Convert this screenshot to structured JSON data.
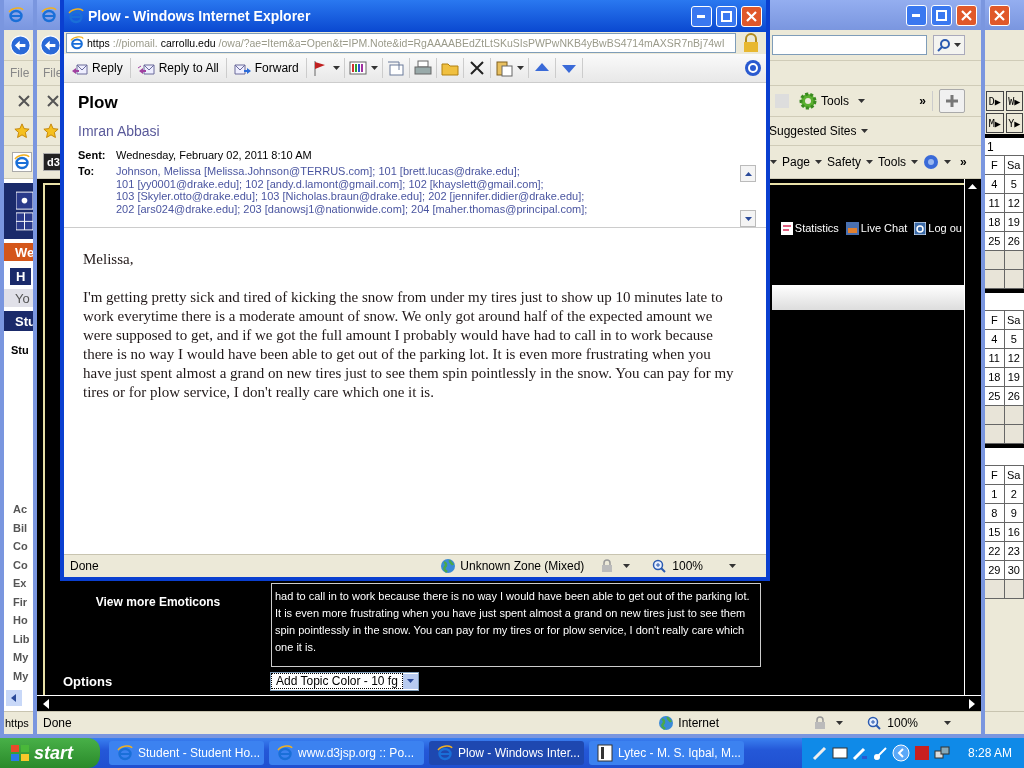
{
  "student_window": {
    "menu_label": "File",
    "sidebar": {
      "banner": "We",
      "tab": "H",
      "greeting": "Yo",
      "section_title": "Stu",
      "heading": "Stu",
      "links": [
        "Ac",
        "Bil",
        "Co",
        "Co",
        "Ex",
        "Fir",
        "Ho",
        "Lib",
        "My",
        "My"
      ]
    },
    "status": "https",
    "calendar": {
      "nav_buttons": [
        "D▶",
        "W▶",
        "M▶",
        "Y▶"
      ],
      "months": [
        {
          "title": "1",
          "headers": [
            "F",
            "Sa"
          ],
          "weeks": [
            {
              "kind": "days",
              "days": [
                "4",
                "5"
              ]
            },
            {
              "kind": "days",
              "days": [
                "11",
                "12"
              ]
            },
            {
              "kind": "days",
              "days": [
                "18",
                "19"
              ]
            },
            {
              "kind": "days",
              "days": [
                "25",
                "26"
              ]
            },
            {
              "kind": "blank"
            },
            {
              "kind": "blank"
            }
          ]
        },
        {
          "headers": [
            "F",
            "Sa"
          ],
          "weeks": [
            {
              "kind": "days",
              "days": [
                "4",
                "5"
              ]
            },
            {
              "kind": "days",
              "days": [
                "11",
                "12"
              ]
            },
            {
              "kind": "days",
              "days": [
                "18",
                "19"
              ]
            },
            {
              "kind": "days",
              "days": [
                "25",
                "26"
              ]
            },
            {
              "kind": "blank"
            },
            {
              "kind": "blank"
            }
          ]
        },
        {
          "headers": [
            "F",
            "Sa"
          ],
          "weeks": [
            {
              "kind": "days",
              "days": [
                "1",
                "2"
              ]
            },
            {
              "kind": "days",
              "days": [
                "8",
                "9"
              ]
            },
            {
              "kind": "days",
              "days": [
                "15",
                "16"
              ]
            },
            {
              "kind": "days",
              "days": [
                "22",
                "23"
              ]
            },
            {
              "kind": "days",
              "days": [
                "29",
                "30"
              ]
            },
            {
              "kind": "blank"
            }
          ]
        }
      ]
    }
  },
  "forum_window": {
    "menu_label": "File",
    "tab_label": "d3",
    "command_bar": {
      "tools": "Tools",
      "chevron": "»"
    },
    "favorites": {
      "label": "Suggested Sites"
    },
    "page_menu": {
      "items": [
        "Page",
        "Safety",
        "Tools"
      ],
      "chevron": "»"
    },
    "nav_links": [
      {
        "label": "Statistics",
        "kind": "chart"
      },
      {
        "label": "Live Chat",
        "kind": "chat"
      },
      {
        "label": "Log ou",
        "kind": "logout"
      }
    ],
    "post_text": "had to call in to work because there is no way I would have been able to get out of the parking lot. It is even more frustrating when you have just spent almost a grand on new tires just to see them spin pointlessly in the snow. You can pay for my tires or for plow service, I don't really care which one it is.",
    "emoticons_link": "View more Emoticons",
    "options_label": "Options",
    "color_select": "Add Topic Color - 10 fg",
    "status": "Done",
    "zone": "Internet",
    "zoom": "100%"
  },
  "email_window": {
    "title": "Plow - Windows Internet Explorer",
    "address": [
      {
        "text": "https",
        "emphasis": true
      },
      {
        "text": "://piomail.",
        "emphasis": false
      },
      {
        "text": "carrollu.edu",
        "emphasis": true
      },
      {
        "text": "/owa/?ae=Item&a=Open&t=IPM.Note&id=RgAAAABEdZtLtSKuSIsPWPwNKB4yBwBS4714mAXSR7nBj74wI",
        "emphasis": false
      }
    ],
    "toolbar": [
      {
        "label": "Reply",
        "kind": "reply"
      },
      {
        "label": "Reply to All",
        "kind": "reply_all"
      },
      {
        "label": "Forward",
        "kind": "forward"
      }
    ],
    "subject": "Plow",
    "sender": "Imran Abbasi",
    "sent_label": "Sent:",
    "sent": "Wednesday, February 02, 2011 8:10 AM",
    "to_label": "To:",
    "recipients": [
      "Johnson, Melissa [Melissa.Johnson@TERRUS.com]; 101 [brett.lucas@drake.edu];",
      "101 [yy0001@drake.edu]; 102 [andy.d.lamont@gmail.com]; 102 [khayslett@gmail.com];",
      "103 [Skyler.otto@drake.edu]; 103 [Nicholas.braun@drake.edu]; 202 [jennifer.didier@drake.edu];",
      "202 [ars024@drake.edu]; 203 [danowsj1@nationwide.com]; 204 [maher.thomas@principal.com];"
    ],
    "greeting": "Melissa,",
    "body": "I'm getting pretty sick and tired of kicking the snow from under my tires just to show up 10 minutes late to work everytime there is a moderate amount of snow. We only got around half of the expected amount we were supposed to get, and if we got the full amount I probably would have had to call in to work because there is no way I would have been able to get out of the parking lot. It is even more frustrating when you have just spent almost a grand on new tires just to see them spin pointlessly in the snow. You can pay for my tires or for plow service, I don't really care which one it is.",
    "status": "Done",
    "zone": "Unknown Zone (Mixed)",
    "zoom": "100%"
  },
  "taskbar": {
    "start": "start",
    "tasks": [
      {
        "label": "Student - Student Ho...",
        "kind": "browser",
        "selected": false
      },
      {
        "label": "www.d3jsp.org :: Po...",
        "kind": "browser",
        "selected": false
      },
      {
        "label": "Plow - Windows Inter...",
        "kind": "browser",
        "selected": true
      },
      {
        "label": "Lytec - M. S. Iqbal, M...",
        "kind": "document",
        "selected": false
      }
    ],
    "clock": "8:28 AM"
  }
}
